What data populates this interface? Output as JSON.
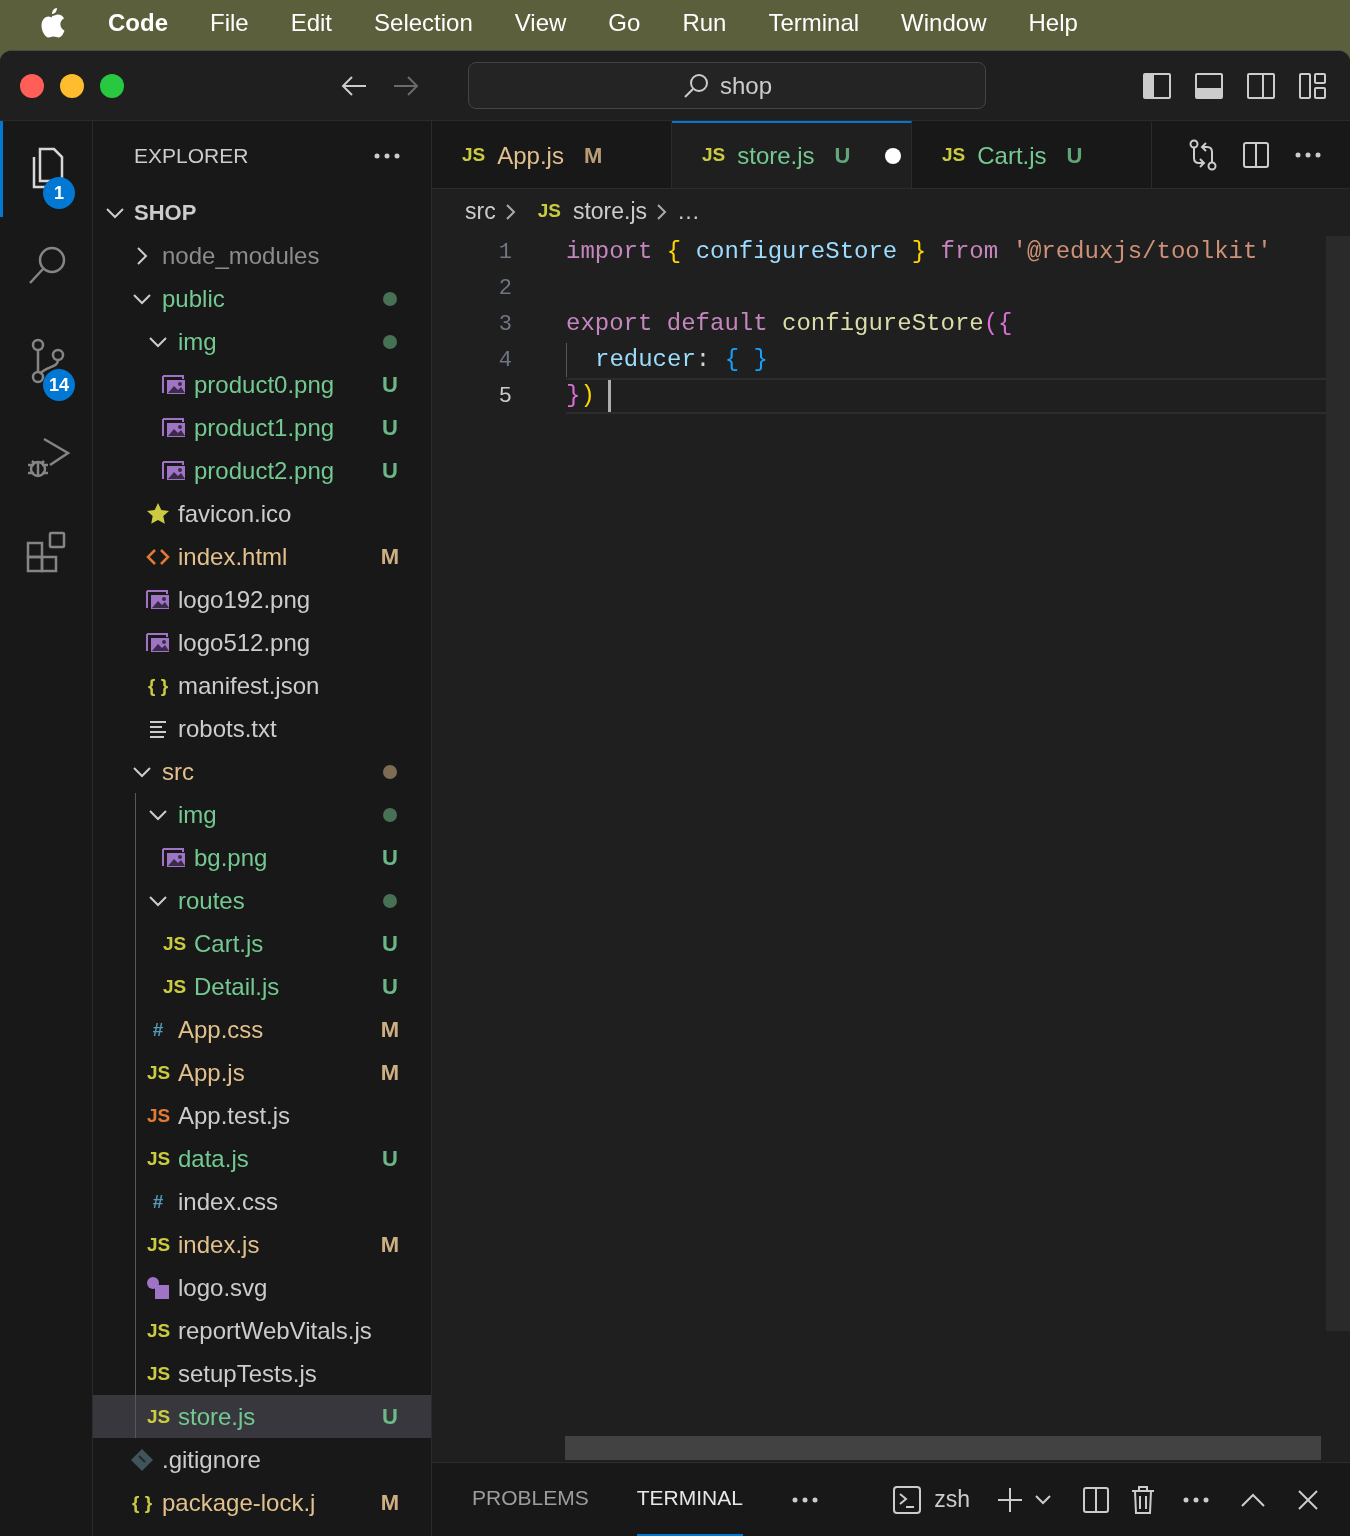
{
  "menu_bar": {
    "items": [
      {
        "label": "Code",
        "kind": "app"
      },
      {
        "label": "File",
        "kind": "menu"
      },
      {
        "label": "Edit",
        "kind": "menu"
      },
      {
        "label": "Selection",
        "kind": "menu"
      },
      {
        "label": "View",
        "kind": "menu"
      },
      {
        "label": "Go",
        "kind": "menu"
      },
      {
        "label": "Run",
        "kind": "menu"
      },
      {
        "label": "Terminal",
        "kind": "menu"
      },
      {
        "label": "Window",
        "kind": "menu"
      },
      {
        "label": "Help",
        "kind": "menu"
      }
    ]
  },
  "title_bar": {
    "back_disabled": false,
    "forward_disabled": true,
    "search": {
      "value": "shop"
    },
    "layout_toggles": [
      {
        "kind": "primary_sidebar",
        "on": true
      },
      {
        "kind": "panel",
        "on": true
      },
      {
        "kind": "secondary_sidebar",
        "on": false
      },
      {
        "kind": "customize"
      }
    ]
  },
  "activity_bar": {
    "items": [
      {
        "kind": "explorer",
        "selected": true,
        "badge": "1"
      },
      {
        "kind": "search",
        "selected": false
      },
      {
        "kind": "source_control",
        "selected": false,
        "badge": "14"
      },
      {
        "kind": "run",
        "selected": false
      },
      {
        "kind": "extensions",
        "selected": false
      }
    ]
  },
  "explorer": {
    "title": "EXPLORER",
    "root": {
      "name": "SHOP",
      "expanded": true,
      "children": [
        {
          "name": "node_modules",
          "kind": "folder",
          "expanded": false,
          "color": "#8c8c8c",
          "selected": false
        },
        {
          "name": "public",
          "kind": "folder",
          "expanded": true,
          "color": "#73c991",
          "dot": true,
          "selected": false,
          "children": [
            {
              "name": "img",
              "kind": "folder",
              "expanded": true,
              "color": "#73c991",
              "dot": true,
              "selected": false,
              "children": [
                {
                  "name": "product0.png",
                  "kind": "image",
                  "color": "#73c991",
                  "badge": "U",
                  "selected": false
                },
                {
                  "name": "product1.png",
                  "kind": "image",
                  "color": "#73c991",
                  "badge": "U",
                  "selected": false
                },
                {
                  "name": "product2.png",
                  "kind": "image",
                  "color": "#73c991",
                  "badge": "U",
                  "selected": false
                }
              ]
            },
            {
              "name": "favicon.ico",
              "kind": "star",
              "color": "#cccccc",
              "selected": false
            },
            {
              "name": "index.html",
              "kind": "html",
              "color": "#e2c08d",
              "badge": "M",
              "selected": false
            },
            {
              "name": "logo192.png",
              "kind": "image",
              "color": "#cccccc",
              "selected": false
            },
            {
              "name": "logo512.png",
              "kind": "image",
              "color": "#cccccc",
              "selected": false
            },
            {
              "name": "manifest.json",
              "kind": "json",
              "glyph": "{ }",
              "color": "#cccccc",
              "selected": false
            },
            {
              "name": "robots.txt",
              "kind": "text",
              "color": "#cccccc",
              "selected": false
            }
          ]
        },
        {
          "name": "src",
          "kind": "folder",
          "expanded": true,
          "color": "#e2c08d",
          "dot": true,
          "selected": false,
          "children": [
            {
              "name": "img",
              "kind": "folder",
              "expanded": true,
              "color": "#73c991",
              "dot": true,
              "selected": false,
              "children": [
                {
                  "name": "bg.png",
                  "kind": "image",
                  "color": "#73c991",
                  "badge": "U",
                  "selected": false
                }
              ]
            },
            {
              "name": "routes",
              "kind": "folder",
              "expanded": true,
              "color": "#73c991",
              "dot": true,
              "selected": false,
              "children": [
                {
                  "name": "Cart.js",
                  "kind": "js",
                  "glyph": "JS",
                  "color": "#73c991",
                  "badge": "U",
                  "selected": false
                },
                {
                  "name": "Detail.js",
                  "kind": "js",
                  "glyph": "JS",
                  "color": "#73c991",
                  "badge": "U",
                  "selected": false
                }
              ]
            },
            {
              "name": "App.css",
              "kind": "css",
              "glyph": "#",
              "color": "#e2c08d",
              "badge": "M",
              "selected": false
            },
            {
              "name": "App.js",
              "kind": "js",
              "glyph": "JS",
              "color": "#e2c08d",
              "badge": "M",
              "selected": false
            },
            {
              "name": "App.test.js",
              "kind": "js_test",
              "glyph": "JS",
              "color": "#cccccc",
              "selected": false
            },
            {
              "name": "data.js",
              "kind": "js",
              "glyph": "JS",
              "color": "#73c991",
              "badge": "U",
              "selected": false
            },
            {
              "name": "index.css",
              "kind": "css",
              "glyph": "#",
              "color": "#cccccc",
              "selected": false
            },
            {
              "name": "index.js",
              "kind": "js",
              "glyph": "JS",
              "color": "#e2c08d",
              "badge": "M",
              "selected": false
            },
            {
              "name": "logo.svg",
              "kind": "svg",
              "color": "#cccccc",
              "selected": false
            },
            {
              "name": "reportWebVitals.js",
              "kind": "js",
              "glyph": "JS",
              "color": "#cccccc",
              "selected": false
            },
            {
              "name": "setupTests.js",
              "kind": "js",
              "glyph": "JS",
              "color": "#cccccc",
              "selected": false
            },
            {
              "name": "store.js",
              "kind": "js",
              "glyph": "JS",
              "color": "#73c991",
              "badge": "U",
              "selected": true
            }
          ]
        },
        {
          "name": ".gitignore",
          "kind": "git",
          "color": "#cccccc",
          "selected": false
        },
        {
          "name": "package-lock.j",
          "kind": "json",
          "glyph": "{ }",
          "color": "#e2c08d",
          "badge": "M",
          "selected": false
        }
      ]
    }
  },
  "editor": {
    "tabs": [
      {
        "glyph": "JS",
        "label": "App.js",
        "badge": "M",
        "color": "#e2c08d",
        "selected": false,
        "dirty": false
      },
      {
        "glyph": "JS",
        "label": "store.js",
        "badge": "U",
        "color": "#73c991",
        "selected": true,
        "dirty": true
      },
      {
        "glyph": "JS",
        "label": "Cart.js",
        "badge": "U",
        "color": "#73c991",
        "selected": false,
        "dirty": false
      }
    ],
    "breadcrumb": [
      {
        "label": "src"
      },
      {
        "label": "store.js",
        "glyph": "JS"
      },
      {
        "label": "…"
      }
    ],
    "lines": [
      {
        "number": "1",
        "active": false,
        "tokens": [
          {
            "text": "import ",
            "kind": "keyword"
          },
          {
            "text": "{",
            "kind": "bracket_gold"
          },
          {
            "text": " configureStore ",
            "kind": "variable"
          },
          {
            "text": "}",
            "kind": "bracket_gold"
          },
          {
            "text": " from ",
            "kind": "keyword"
          },
          {
            "text": "'@reduxjs/toolkit'",
            "kind": "string"
          }
        ]
      },
      {
        "number": "2",
        "active": false
      },
      {
        "number": "3",
        "active": false,
        "tokens": [
          {
            "text": "export default ",
            "kind": "keyword"
          },
          {
            "text": "configureStore",
            "kind": "function"
          },
          {
            "text": "({",
            "kind": "bracket_orchid"
          }
        ]
      },
      {
        "number": "4",
        "active": false,
        "indent_guide": true,
        "tokens": [
          {
            "text": "reducer",
            "kind": "property"
          },
          {
            "text": ": ",
            "kind": "plain"
          },
          {
            "text": "{ }",
            "kind": "bracket_blue"
          }
        ]
      },
      {
        "number": "5",
        "active": true,
        "tokens": [
          {
            "text": "}",
            "kind": "bracket_orchid"
          },
          {
            "text": ")",
            "kind": "bracket_gold"
          }
        ]
      }
    ]
  },
  "panel": {
    "tabs": [
      {
        "label": "PROBLEMS",
        "selected": false
      },
      {
        "label": "TERMINAL",
        "selected": true
      }
    ],
    "terminal": {
      "name": "zsh"
    }
  }
}
